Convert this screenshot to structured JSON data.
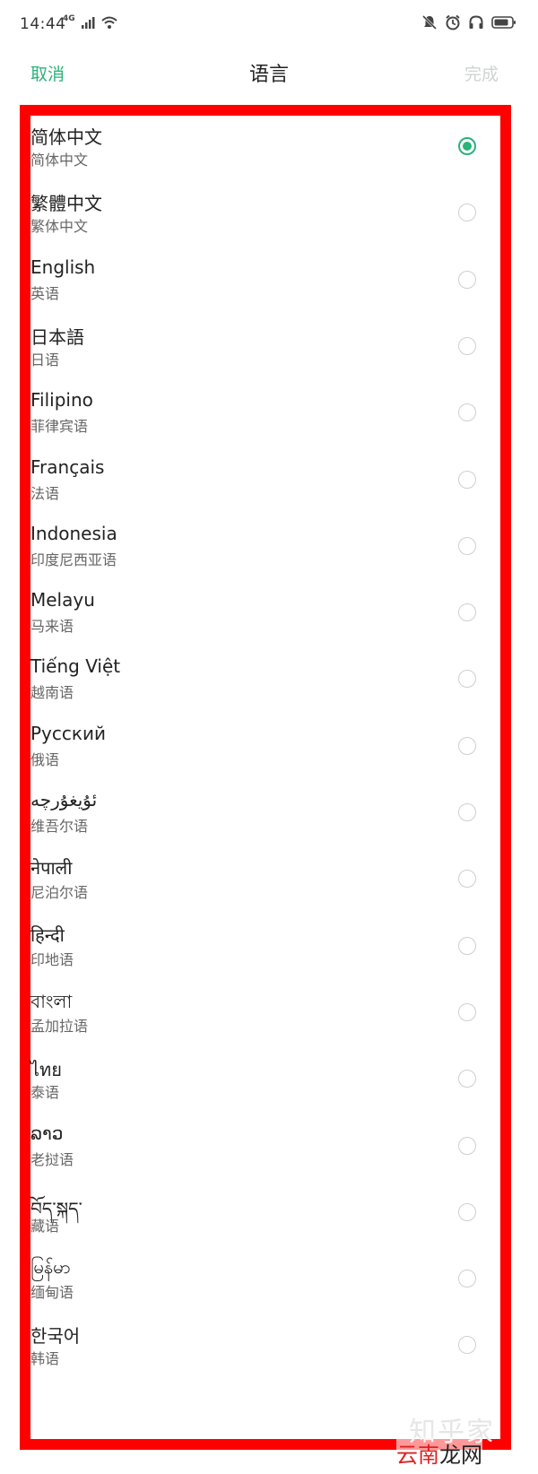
{
  "status_bar": {
    "time": "14:44",
    "network": "4G",
    "icons": [
      "signal-icon",
      "wifi-icon",
      "mute-icon",
      "alarm-icon",
      "headphones-icon",
      "battery-icon"
    ]
  },
  "nav": {
    "cancel_label": "取消",
    "title": "语言",
    "done_label": "完成"
  },
  "languages": [
    {
      "name": "简体中文",
      "sub": "简体中文",
      "selected": true
    },
    {
      "name": "繁體中文",
      "sub": "繁体中文",
      "selected": false
    },
    {
      "name": "English",
      "sub": "英语",
      "selected": false
    },
    {
      "name": "日本語",
      "sub": "日语",
      "selected": false
    },
    {
      "name": "Filipino",
      "sub": "菲律宾语",
      "selected": false
    },
    {
      "name": "Français",
      "sub": "法语",
      "selected": false
    },
    {
      "name": "Indonesia",
      "sub": "印度尼西亚语",
      "selected": false
    },
    {
      "name": "Melayu",
      "sub": "马来语",
      "selected": false
    },
    {
      "name": "Tiếng Việt",
      "sub": "越南语",
      "selected": false
    },
    {
      "name": "Русский",
      "sub": "俄语",
      "selected": false
    },
    {
      "name": "ئۇيغۇرچە",
      "sub": "维吾尔语",
      "selected": false
    },
    {
      "name": "नेपाली",
      "sub": "尼泊尔语",
      "selected": false
    },
    {
      "name": "हिन्दी",
      "sub": "印地语",
      "selected": false
    },
    {
      "name": "বাংলা",
      "sub": "孟加拉语",
      "selected": false
    },
    {
      "name": "ไทย",
      "sub": "泰语",
      "selected": false
    },
    {
      "name": "ລາວ",
      "sub": "老挝语",
      "selected": false
    },
    {
      "name": "བོད་སྐད་",
      "sub": "藏语",
      "selected": false
    },
    {
      "name": "မြန်မာ",
      "sub": "缅甸语",
      "selected": false
    },
    {
      "name": "한국어",
      "sub": "韩语",
      "selected": false
    }
  ],
  "watermark": {
    "text": "知乎家",
    "brand_prefix": "云南",
    "brand_suffix": "龙网"
  },
  "colors": {
    "accent": "#2ab37a",
    "frame": "#ff0000",
    "done_disabled": "#cfd3d1"
  }
}
